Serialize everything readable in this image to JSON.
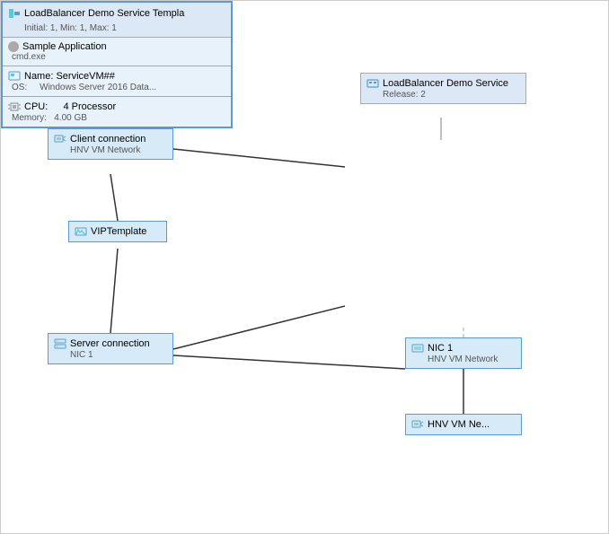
{
  "nodes": {
    "lb_service": {
      "title": "LoadBalancer Demo Service",
      "subtitle": "Release: 2"
    },
    "lb_template": {
      "title": "LoadBalancer Demo Service Templa",
      "subtitle": "Initial: 1, Min: 1, Max: 1",
      "sample": {
        "label": "Sample Application",
        "sub": "cmd.exe"
      },
      "vm": {
        "name_label": "Name: ServiceVM##",
        "os_label": "OS:",
        "os_value": "Windows Server 2016 Data..."
      },
      "cpu": {
        "cpu_label": "CPU:",
        "cpu_value": "4 Processor",
        "mem_label": "Memory:",
        "mem_value": "4.00 GB"
      }
    },
    "client": {
      "title": "Client connection",
      "subtitle": "HNV VM Network"
    },
    "vip": {
      "title": "VIPTemplate"
    },
    "server": {
      "title": "Server connection",
      "subtitle": "NIC 1"
    },
    "nic": {
      "title": "NIC 1",
      "subtitle": "HNV VM Network"
    },
    "hnv": {
      "title": "HNV VM Ne...",
      "subtitle": ""
    }
  }
}
